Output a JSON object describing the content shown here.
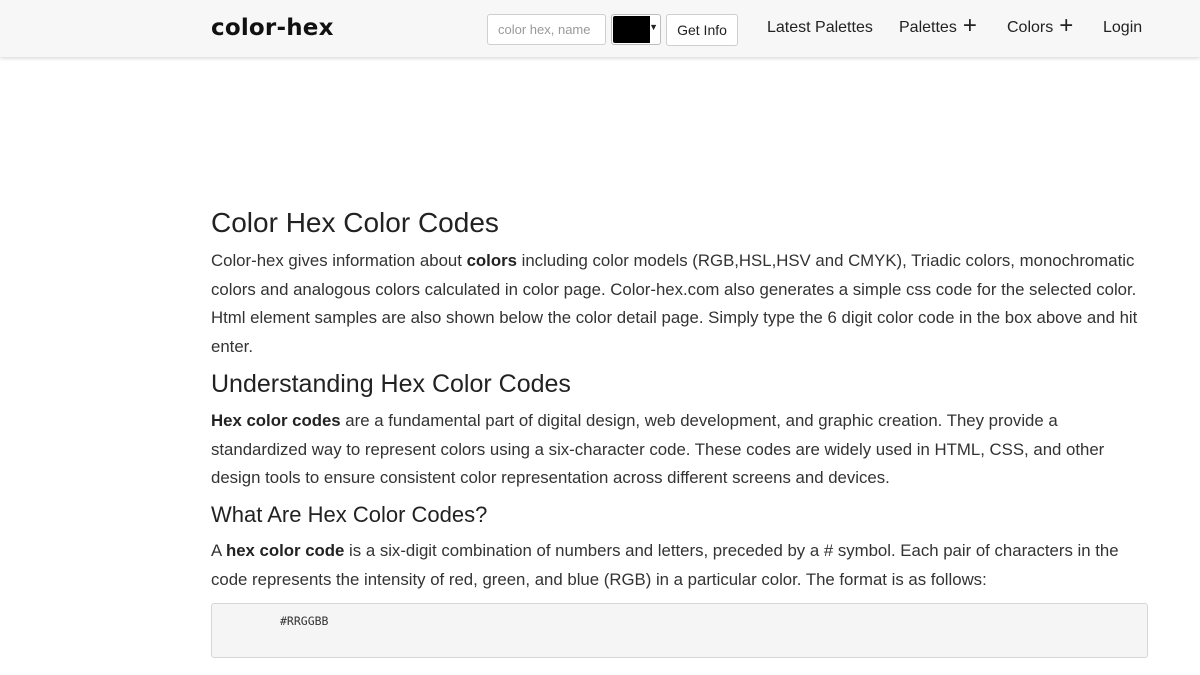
{
  "header": {
    "logo": "color-hex",
    "search_placeholder": "color hex, name",
    "color_swatch": "#000000",
    "get_info_label": "Get Info",
    "nav": {
      "latest_palettes": "Latest Palettes",
      "palettes": "Palettes",
      "colors": "Colors",
      "login": "Login",
      "plus_glyph": "+"
    }
  },
  "content": {
    "title": "Color Hex Color Codes",
    "intro": {
      "before": "Color-hex gives information about ",
      "bold": "colors",
      "after": " including color models (RGB,HSL,HSV and CMYK), Triadic colors, monochromatic colors and analogous colors calculated in color page. Color-hex.com also generates a simple css code for the selected color. Html element samples are also shown below the color detail page. Simply type the 6 digit color code in the box above and hit enter."
    },
    "understanding_heading": "Understanding Hex Color Codes",
    "understanding": {
      "bold": "Hex color codes",
      "after": " are a fundamental part of digital design, web development, and graphic creation. They provide a standardized way to represent colors using a six-character code. These codes are widely used in HTML, CSS, and other design tools to ensure consistent color representation across different screens and devices."
    },
    "what_heading": "What Are Hex Color Codes?",
    "what": {
      "before": "A ",
      "bold": "hex color code",
      "after": " is a six-digit combination of numbers and letters, preceded by a # symbol. Each pair of characters in the code represents the intensity of red, green, and blue (RGB) in a particular color. The format is as follows:"
    },
    "code_sample": "#RRGGBB"
  }
}
